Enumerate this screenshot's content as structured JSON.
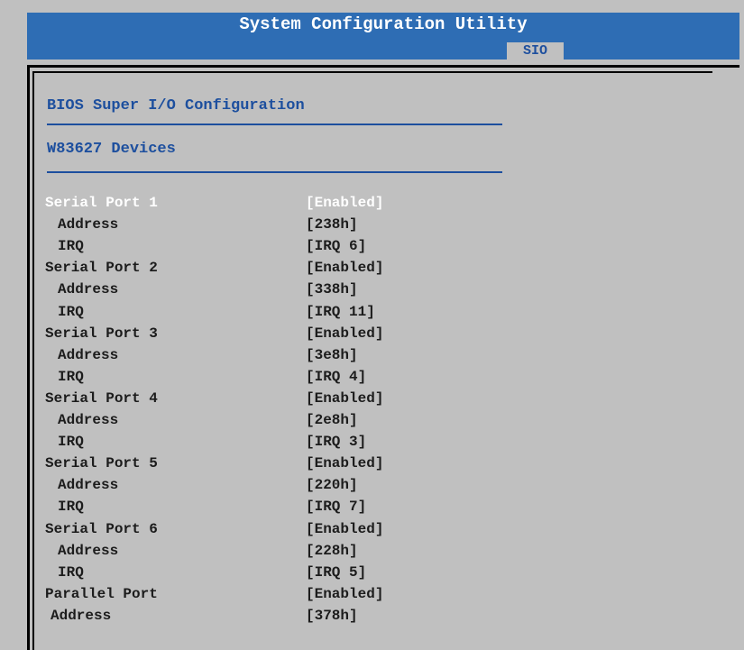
{
  "window": {
    "title": "System Configuration Utility",
    "active_tab": "SIO"
  },
  "content": {
    "heading": "BIOS Super I/O Configuration",
    "subheading": "W83627 Devices"
  },
  "settings": [
    {
      "label": "Serial Port 1",
      "value": "[Enabled]",
      "level": "top",
      "selected": true
    },
    {
      "label": "Address",
      "value": "[238h]",
      "level": "sub"
    },
    {
      "label": "IRQ",
      "value": "[IRQ 6]",
      "level": "sub"
    },
    {
      "label": "Serial Port 2",
      "value": "[Enabled]",
      "level": "top"
    },
    {
      "label": "Address",
      "value": "[338h]",
      "level": "sub"
    },
    {
      "label": "IRQ",
      "value": "[IRQ 11]",
      "level": "sub"
    },
    {
      "label": "Serial Port 3",
      "value": "[Enabled]",
      "level": "top"
    },
    {
      "label": "Address",
      "value": "[3e8h]",
      "level": "sub"
    },
    {
      "label": "IRQ",
      "value": "[IRQ 4]",
      "level": "sub"
    },
    {
      "label": "Serial Port 4",
      "value": "[Enabled]",
      "level": "top"
    },
    {
      "label": "Address",
      "value": "[2e8h]",
      "level": "sub"
    },
    {
      "label": "IRQ",
      "value": "[IRQ 3]",
      "level": "sub"
    },
    {
      "label": "Serial Port 5",
      "value": "[Enabled]",
      "level": "top"
    },
    {
      "label": "Address",
      "value": "[220h]",
      "level": "sub"
    },
    {
      "label": "IRQ",
      "value": "[IRQ 7]",
      "level": "sub"
    },
    {
      "label": "Serial Port 6",
      "value": "[Enabled]",
      "level": "top"
    },
    {
      "label": "Address",
      "value": "[228h]",
      "level": "sub"
    },
    {
      "label": "IRQ",
      "value": "[IRQ 5]",
      "level": "sub"
    },
    {
      "label": "Parallel Port",
      "value": "[Enabled]",
      "level": "top"
    },
    {
      "label": "Address",
      "value": "[378h]",
      "level": "parallel-sub"
    }
  ],
  "colors": {
    "title_bar": "#2e6db4",
    "background": "#c0c0c0",
    "heading_text": "#1d4f9e",
    "item_text": "#1c1c1c",
    "selected_text": "#ffffff"
  }
}
